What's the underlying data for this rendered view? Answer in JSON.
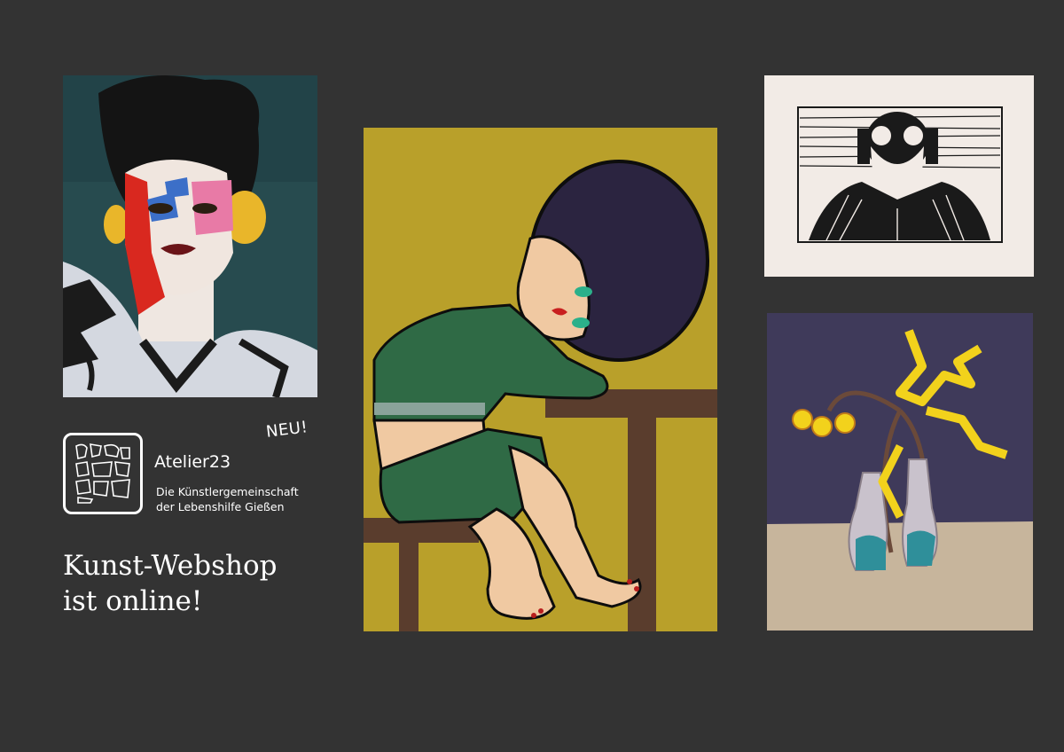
{
  "badge": {
    "label": "NEU!"
  },
  "brand": {
    "name": "Atelier23",
    "tagline_line1": "Die Künstlergemeinschaft",
    "tagline_line2": "der Lebenshilfe Gießen"
  },
  "headline": {
    "line1": "Kunst-Webshop",
    "line2": "ist online!"
  },
  "colors": {
    "background": "#333333",
    "text": "#ffffff",
    "ochre": "#b9a02a",
    "green": "#2f6a45",
    "purple": "#3f3a5a"
  }
}
